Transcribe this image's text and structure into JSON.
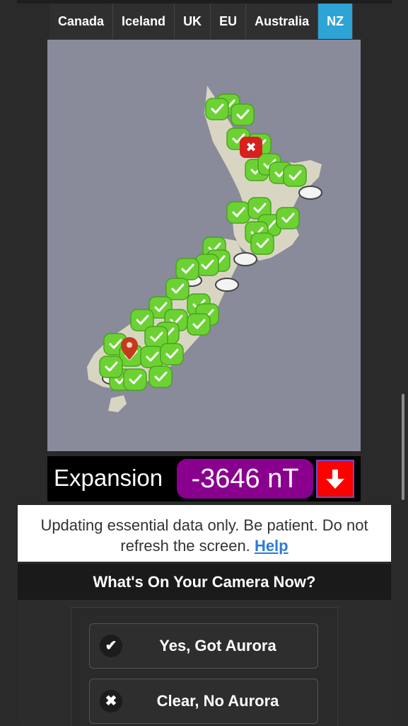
{
  "tabs": [
    {
      "label": "Canada",
      "active": false
    },
    {
      "label": "Iceland",
      "active": false
    },
    {
      "label": "UK",
      "active": false
    },
    {
      "label": "EU",
      "active": false
    },
    {
      "label": "Australia",
      "active": false
    },
    {
      "label": "NZ",
      "active": true
    }
  ],
  "map": {
    "icons": [
      "check-marker-icon",
      "error-marker-icon",
      "cloud-icon",
      "location-pin-icon"
    ]
  },
  "expansion": {
    "label": "Expansion",
    "value": "-3646 nT",
    "arrow_icon": "arrow-down-icon",
    "value_color": "#8a008e",
    "arrow_color": "#ff0000"
  },
  "notice": {
    "text": "Updating essential data only. Be patient. Do not refresh the screen.",
    "link": "Help"
  },
  "camera": {
    "title": "What's On Your Camera Now?",
    "yes_label": "Yes, Got Aurora",
    "no_label": "Clear, No Aurora"
  },
  "colors": {
    "active_tab": "#2ea3d6",
    "map_water": "#898a9a",
    "land": "#d8d6c2",
    "check_marker": "#6cd234",
    "error_marker": "#d8201e"
  }
}
